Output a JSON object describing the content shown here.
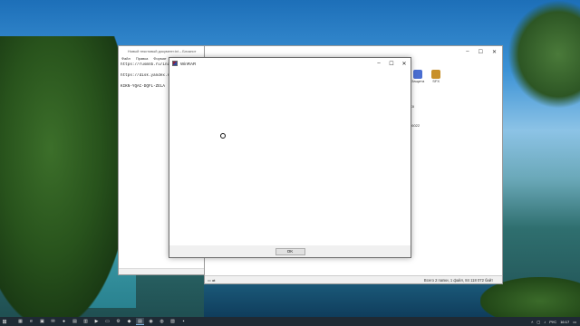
{
  "notepad": {
    "title": "Новый текстовый документ.txt – Блокнот",
    "menu": [
      "Файл",
      "Правка",
      "Формат"
    ],
    "lines": [
      "https://rusmnb.ru/ind",
      "",
      "https://disk.yandex.r",
      "",
      "KIKN-YQAC-DQFL-ZELA"
    ]
  },
  "winrar": {
    "toolbar": [
      {
        "label": "Защита",
        "icon": "shield-icon",
        "color": "#4a6ed1"
      },
      {
        "label": "SFX",
        "icon": "sfx-archive-icon",
        "color": "#c8902a"
      }
    ],
    "rows": [
      "CII",
      "86022"
    ],
    "status_left": "",
    "status_right": "Всего 2 папки, 1 файл, 84 118 072 байт"
  },
  "dialog": {
    "title": "WinRAR",
    "ok_label": "OK"
  },
  "taskbar": {
    "apps": [
      "file-explorer-icon",
      "edge-icon",
      "store-icon",
      "mail-icon",
      "chrome-icon",
      "winrar-icon",
      "notepad-icon",
      "media-icon",
      "folder-icon",
      "settings-icon",
      "game-icon",
      "discord-icon",
      "steam-icon",
      "app-icon",
      "photos-icon",
      "terminal-icon"
    ],
    "lang": "РУС",
    "time": "16:17"
  }
}
